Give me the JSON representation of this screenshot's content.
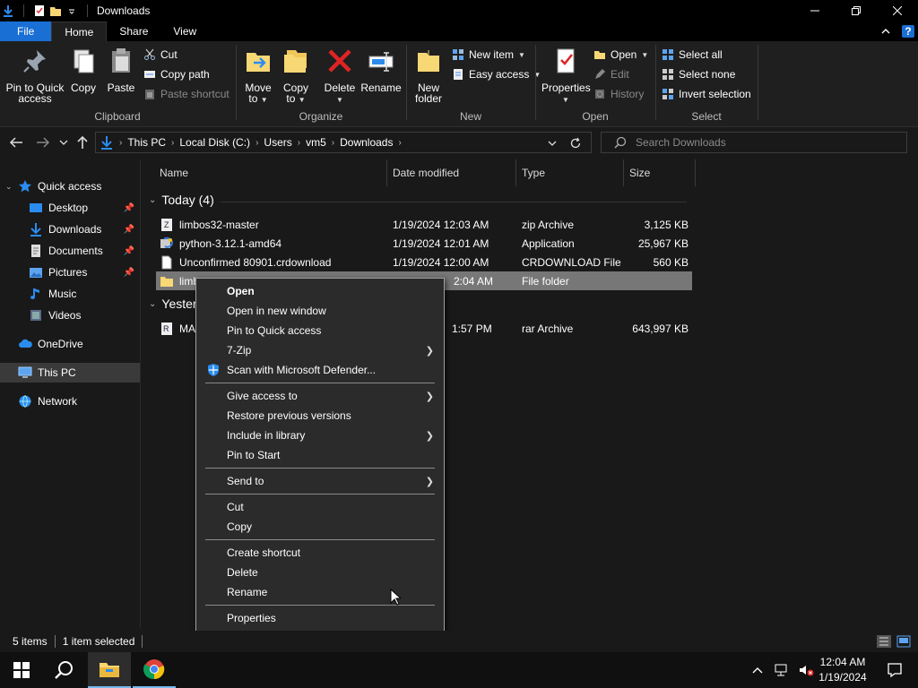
{
  "window": {
    "title": "Downloads"
  },
  "tabs": [
    {
      "label": "File"
    },
    {
      "label": "Home"
    },
    {
      "label": "Share"
    },
    {
      "label": "View"
    }
  ],
  "help_label": "?",
  "ribbon": {
    "clipboard": {
      "label": "Clipboard",
      "pin": "Pin to Quick access",
      "copy": "Copy",
      "paste": "Paste",
      "cut": "Cut",
      "copy_path": "Copy path",
      "paste_shortcut": "Paste shortcut"
    },
    "organize": {
      "label": "Organize",
      "move_to": "Move to",
      "copy_to": "Copy to",
      "delete": "Delete",
      "rename": "Rename"
    },
    "new": {
      "label": "New",
      "new_folder": "New folder",
      "new_item": "New item",
      "easy_access": "Easy access"
    },
    "open": {
      "label": "Open",
      "properties": "Properties",
      "open": "Open",
      "edit": "Edit",
      "history": "History"
    },
    "select": {
      "label": "Select",
      "select_all": "Select all",
      "select_none": "Select none",
      "invert": "Invert selection"
    }
  },
  "address": {
    "crumbs": [
      "This PC",
      "Local Disk (C:)",
      "Users",
      "vm5",
      "Downloads"
    ],
    "search_placeholder": "Search Downloads"
  },
  "nav": {
    "quick_access": "Quick access",
    "desktop": "Desktop",
    "downloads": "Downloads",
    "documents": "Documents",
    "pictures": "Pictures",
    "music": "Music",
    "videos": "Videos",
    "onedrive": "OneDrive",
    "this_pc": "This PC",
    "network": "Network"
  },
  "columns": {
    "name": "Name",
    "date": "Date modified",
    "type": "Type",
    "size": "Size"
  },
  "groups": {
    "today": "Today (4)",
    "yesterday": "Yester"
  },
  "files": [
    {
      "name": "limbos32-master",
      "date": "1/19/2024 12:03 AM",
      "type": "zip Archive",
      "size": "3,125 KB"
    },
    {
      "name": "python-3.12.1-amd64",
      "date": "1/19/2024 12:01 AM",
      "type": "Application",
      "size": "25,967 KB"
    },
    {
      "name": "Unconfirmed 80901.crdownload",
      "date": "1/19/2024 12:00 AM",
      "type": "CRDOWNLOAD File",
      "size": "560 KB"
    },
    {
      "name": "limb",
      "date": "2:04 AM",
      "type": "File folder",
      "size": ""
    },
    {
      "name": "MA",
      "date": "1:57 PM",
      "type": "rar Archive",
      "size": "643,997 KB"
    }
  ],
  "context_menu": {
    "open": "Open",
    "open_new_window": "Open in new window",
    "pin_quick": "Pin to Quick access",
    "seven_zip": "7-Zip",
    "scan": "Scan with Microsoft Defender...",
    "give_access": "Give access to",
    "restore": "Restore previous versions",
    "include_library": "Include in library",
    "pin_start": "Pin to Start",
    "send_to": "Send to",
    "cut": "Cut",
    "copy": "Copy",
    "create_shortcut": "Create shortcut",
    "delete": "Delete",
    "rename": "Rename",
    "properties": "Properties"
  },
  "status": {
    "items": "5 items",
    "selected": "1 item selected"
  },
  "clock": {
    "time": "12:04 AM",
    "date": "1/19/2024"
  },
  "colors": {
    "accent": "#1a6fd4",
    "selection": "#777777",
    "menu_bg": "#2b2b2b"
  }
}
